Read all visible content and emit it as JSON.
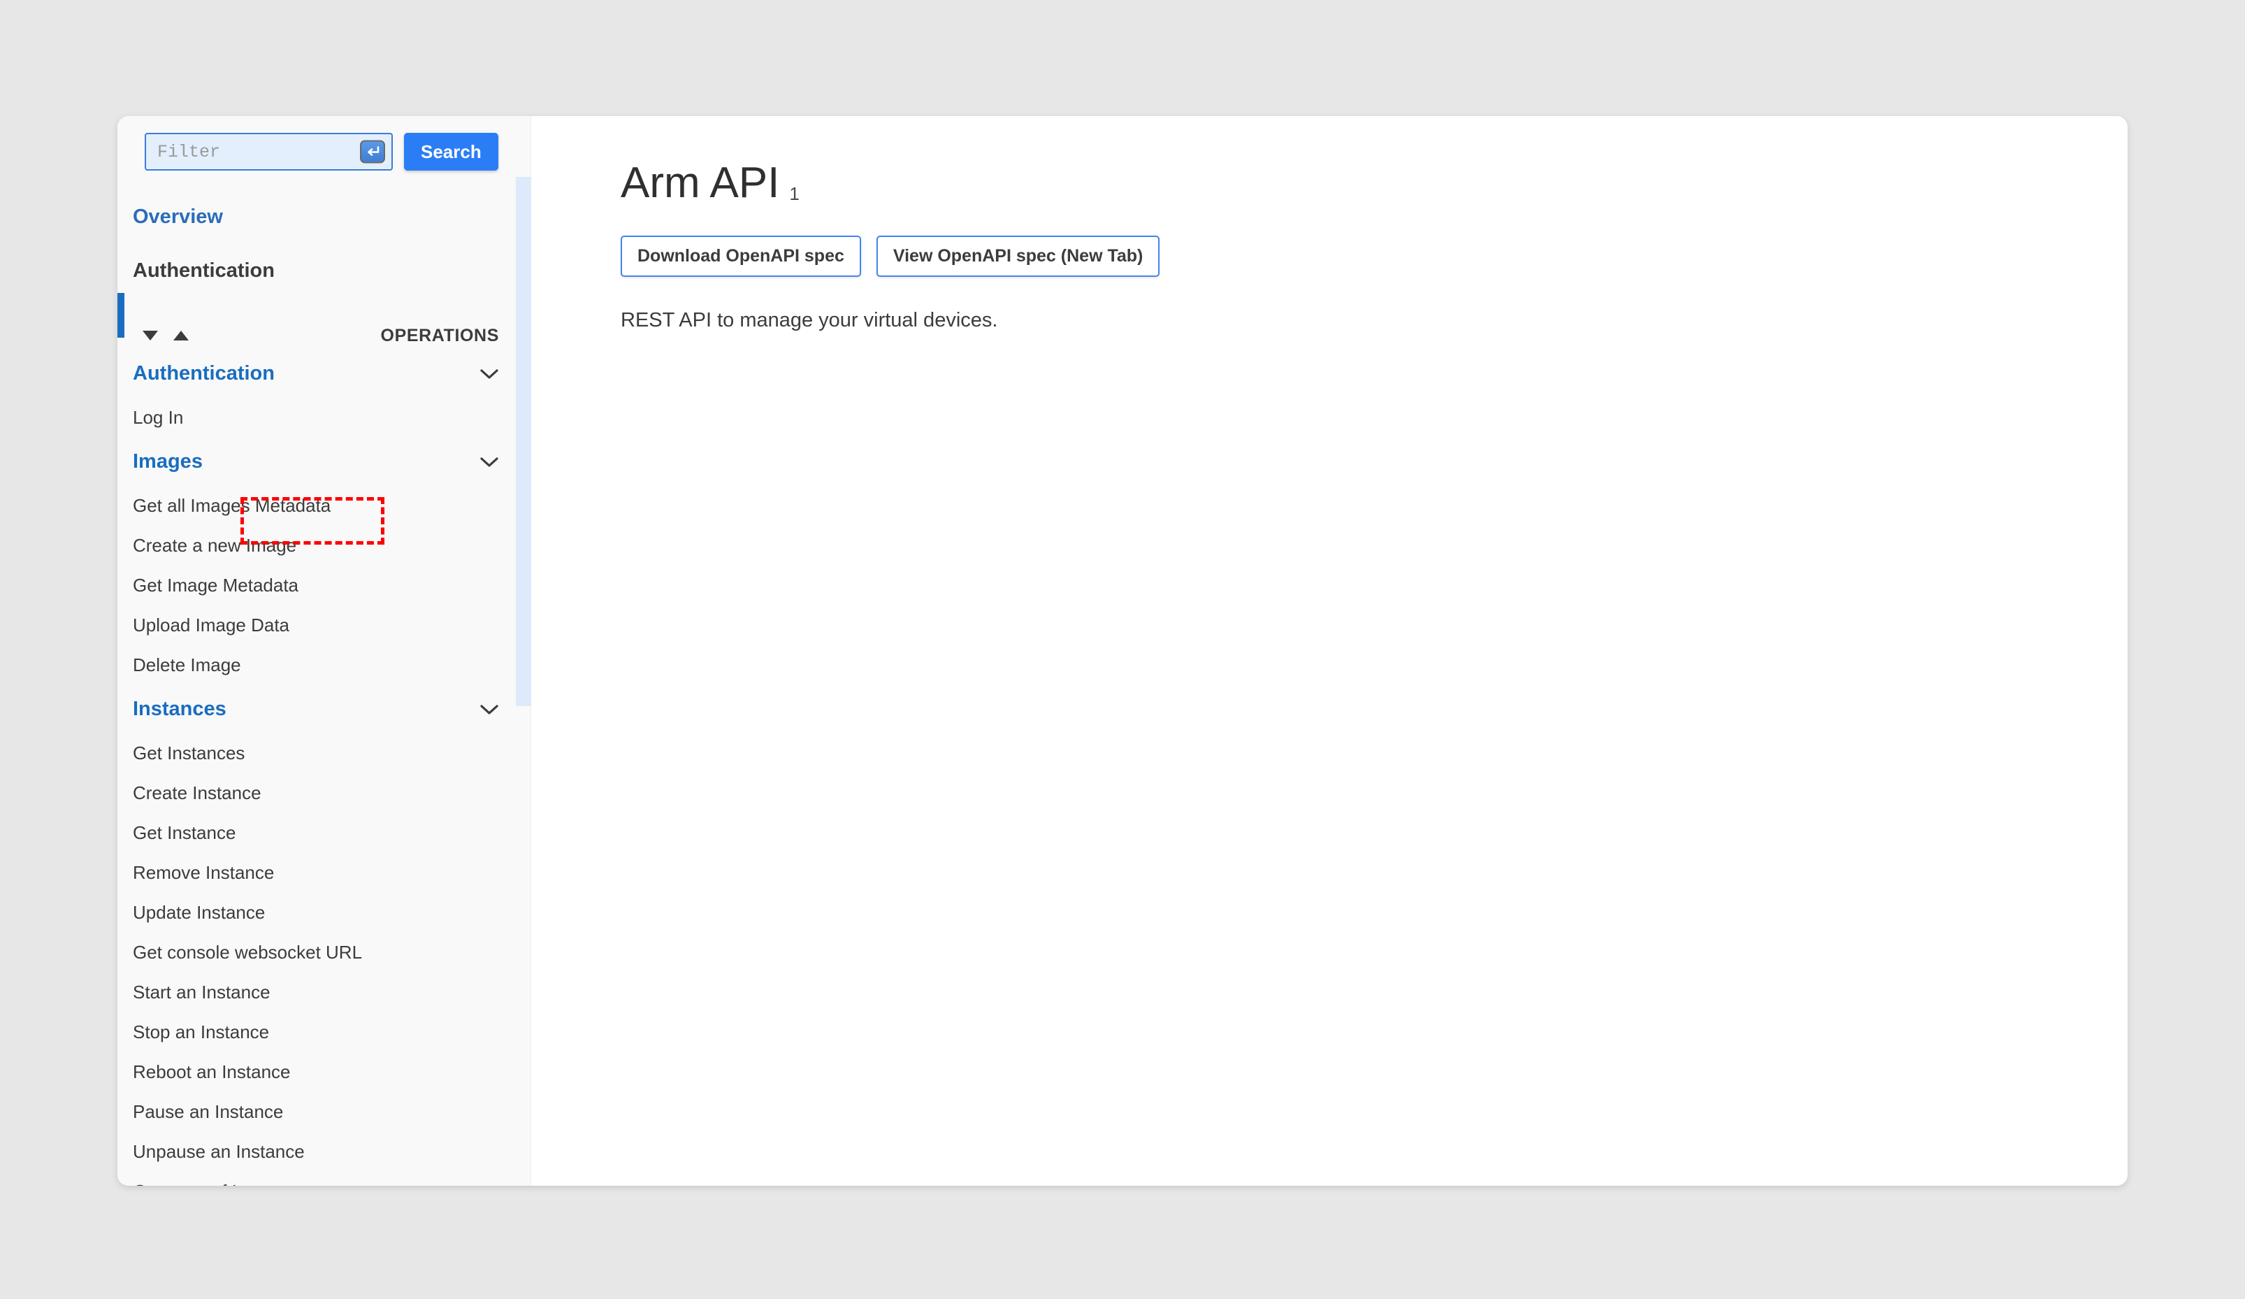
{
  "search": {
    "filter_placeholder": "Filter",
    "filter_value": "",
    "enter_key_icon": "enter-key-icon",
    "search_label": "Search"
  },
  "sidebar": {
    "nav": [
      {
        "label": "Overview",
        "active": true
      },
      {
        "label": "Authentication",
        "active": false
      }
    ],
    "operations_header": {
      "sort_desc_icon": "triangle-down-icon",
      "sort_asc_icon": "triangle-up-icon",
      "label": "OPERATIONS"
    },
    "groups": [
      {
        "title": "Authentication",
        "chevron_icon": "chevron-down-icon",
        "items": [
          "Log In"
        ]
      },
      {
        "title": "Images",
        "chevron_icon": "chevron-down-icon",
        "items": [
          "Get all Images Metadata",
          "Create a new Image",
          "Get Image Metadata",
          "Upload Image Data",
          "Delete Image"
        ]
      },
      {
        "title": "Instances",
        "chevron_icon": "chevron-down-icon",
        "items": [
          "Get Instances",
          "Create Instance",
          "Get Instance",
          "Remove Instance",
          "Update Instance",
          "Get console websocket URL",
          "Start an Instance",
          "Stop an Instance",
          "Reboot an Instance",
          "Pause an Instance",
          "Unpause an Instance",
          "Get state of Instance"
        ]
      }
    ]
  },
  "content": {
    "title": "Arm API",
    "version": "1",
    "buttons": [
      "Download OpenAPI spec",
      "View OpenAPI spec (New Tab)"
    ],
    "description": "REST API to manage your virtual devices."
  },
  "colors": {
    "accent_blue": "#1a6dc0",
    "link_blue": "#2b6cb8",
    "button_blue": "#2b7df5",
    "border_blue": "#4285f4",
    "annotation_red": "#fe0000",
    "page_background": "#e7e7e7",
    "sidebar_background": "#f9f9f9",
    "scrollbar_blue": "#ddeafb"
  }
}
